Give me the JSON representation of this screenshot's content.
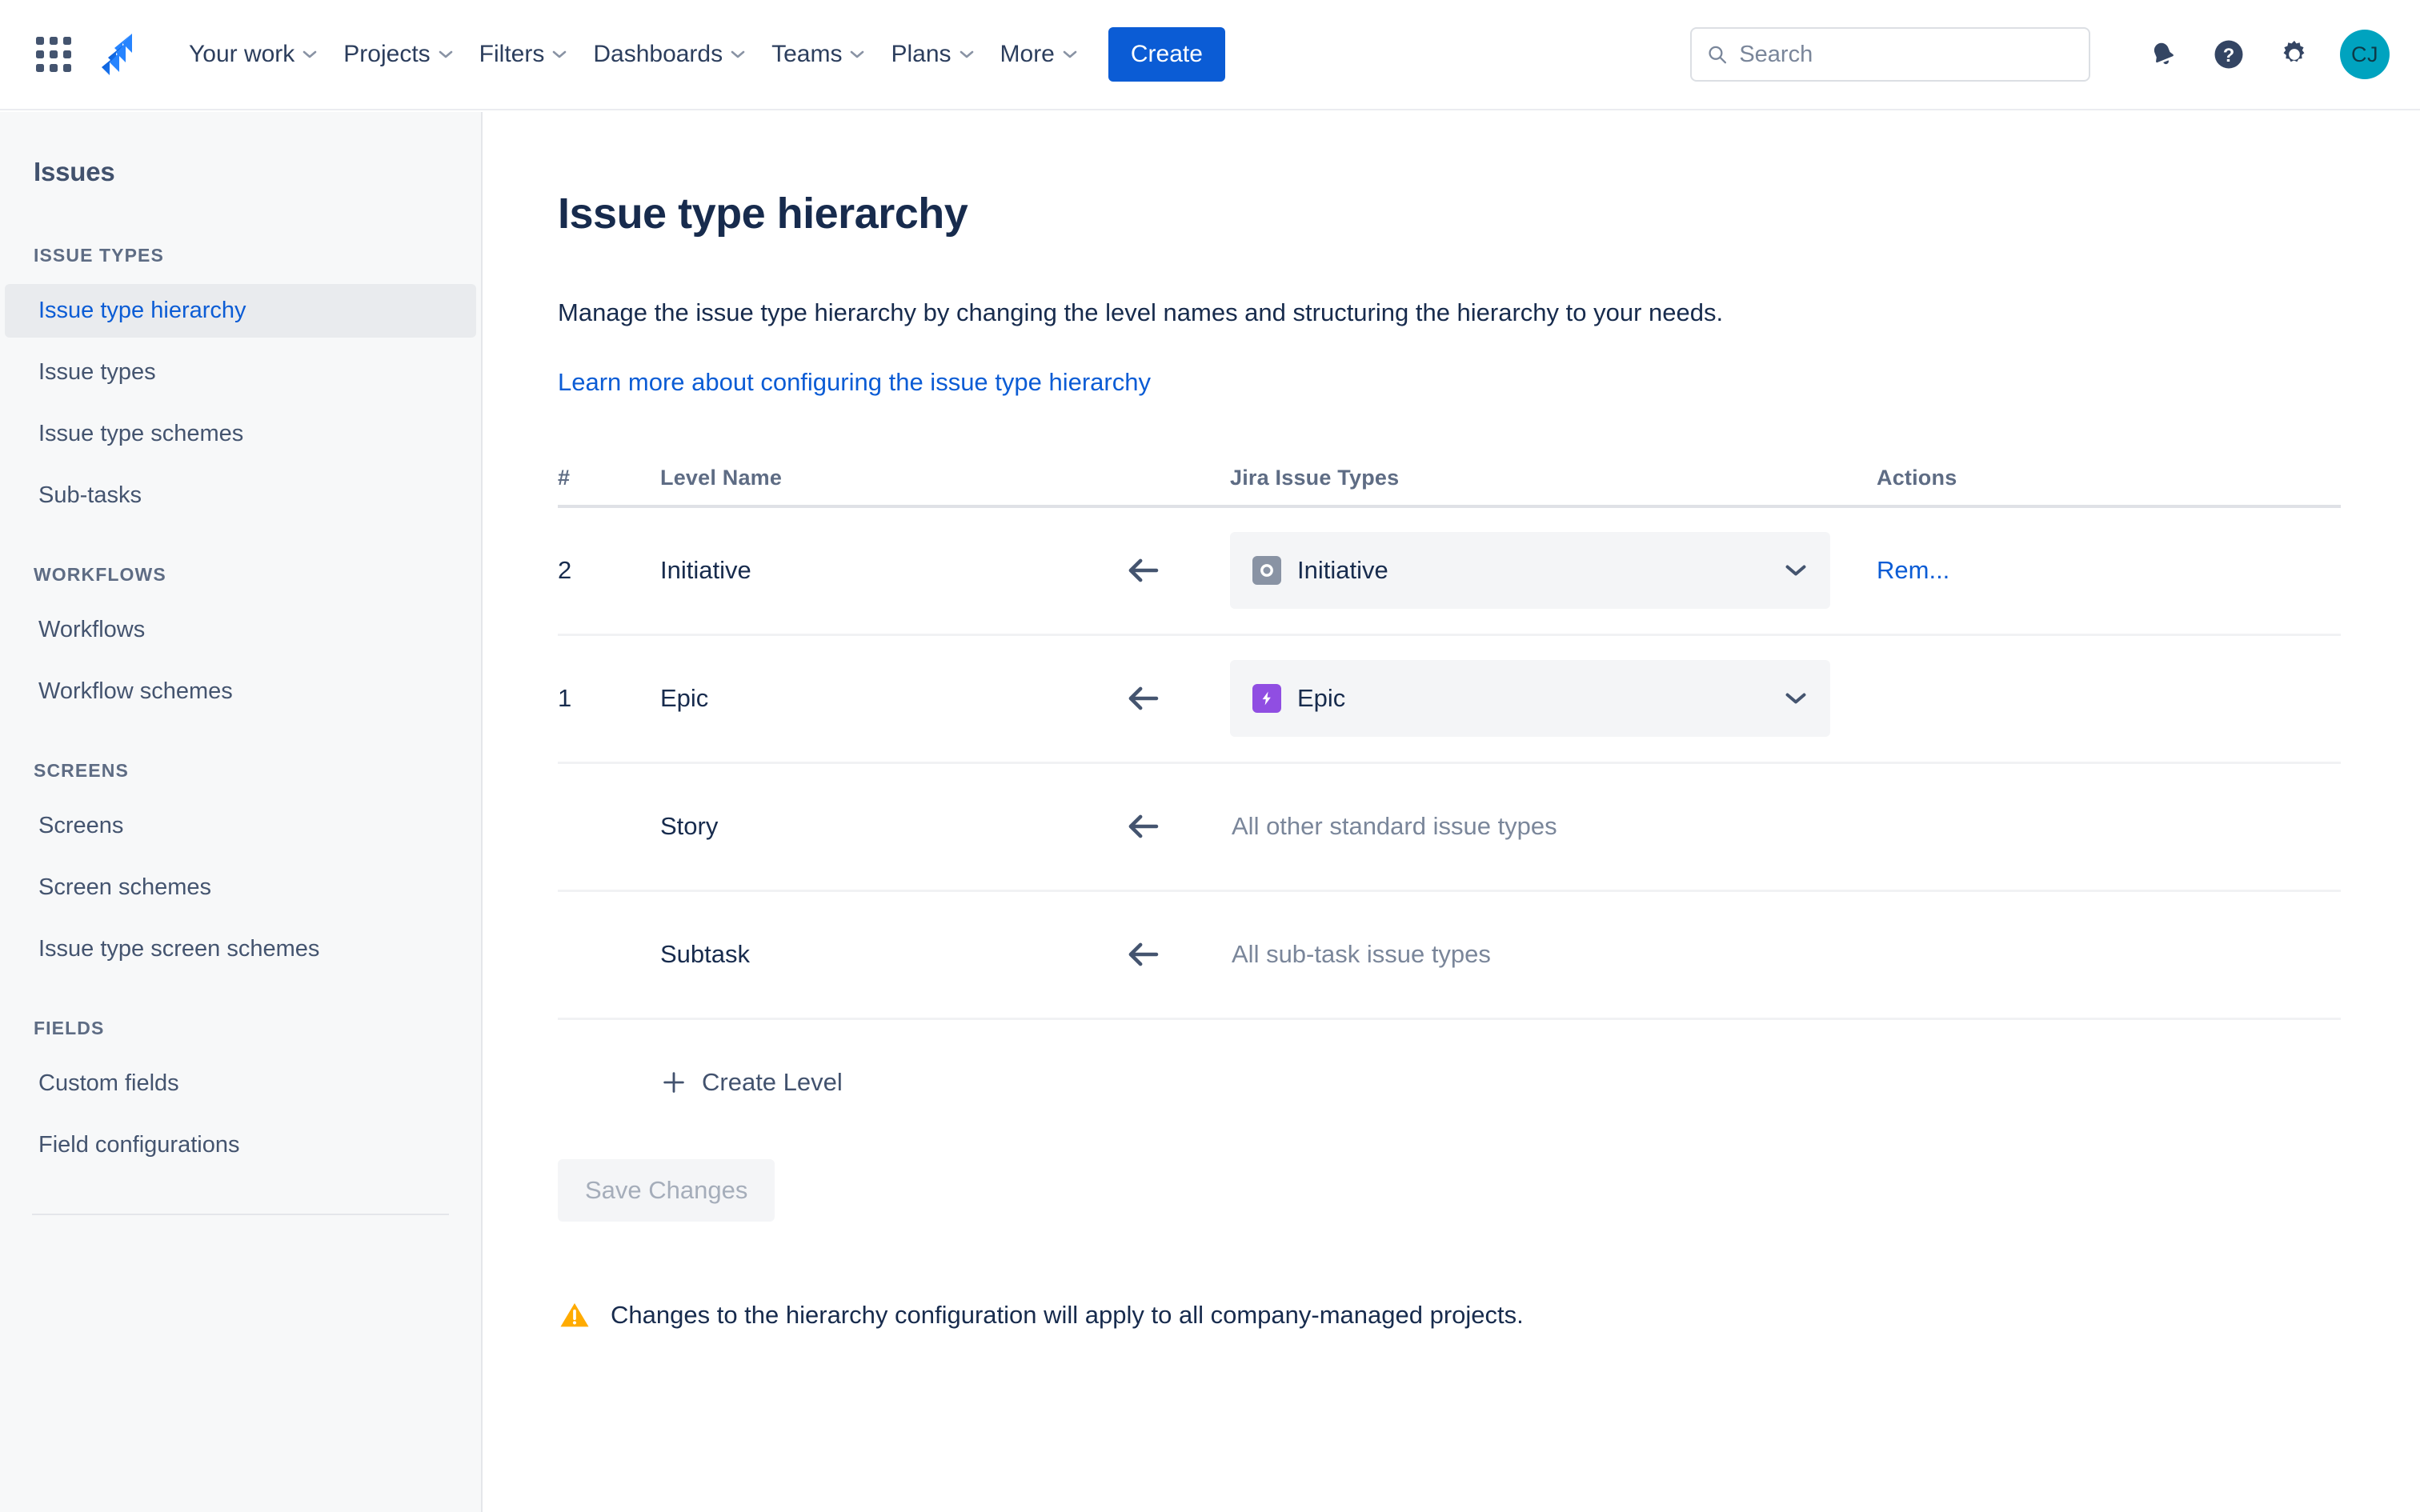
{
  "topnav": {
    "app_switcher_icon": "grid-apps-icon",
    "logo_icon": "jira-logo-icon",
    "items": [
      {
        "label": "Your work",
        "has_chevron": true
      },
      {
        "label": "Projects",
        "has_chevron": true
      },
      {
        "label": "Filters",
        "has_chevron": true
      },
      {
        "label": "Dashboards",
        "has_chevron": true
      },
      {
        "label": "Teams",
        "has_chevron": true
      },
      {
        "label": "Plans",
        "has_chevron": true
      },
      {
        "label": "More",
        "has_chevron": true
      }
    ],
    "create_label": "Create",
    "search": {
      "placeholder": "Search",
      "value": "",
      "icon": "search-icon"
    },
    "notifications_icon": "bell-icon",
    "help_icon": "help-circle-icon",
    "settings_icon": "gear-icon",
    "avatar_initials": "CJ"
  },
  "sidebar": {
    "title": "Issues",
    "groups": [
      {
        "heading": "ISSUE TYPES",
        "items": [
          {
            "label": "Issue type hierarchy",
            "active": true
          },
          {
            "label": "Issue types",
            "active": false
          },
          {
            "label": "Issue type schemes",
            "active": false
          },
          {
            "label": "Sub-tasks",
            "active": false
          }
        ]
      },
      {
        "heading": "WORKFLOWS",
        "items": [
          {
            "label": "Workflows",
            "active": false
          },
          {
            "label": "Workflow schemes",
            "active": false
          }
        ]
      },
      {
        "heading": "SCREENS",
        "items": [
          {
            "label": "Screens",
            "active": false
          },
          {
            "label": "Screen schemes",
            "active": false
          },
          {
            "label": "Issue type screen schemes",
            "active": false
          }
        ]
      },
      {
        "heading": "FIELDS",
        "items": [
          {
            "label": "Custom fields",
            "active": false
          },
          {
            "label": "Field configurations",
            "active": false
          }
        ]
      }
    ]
  },
  "main": {
    "title": "Issue type hierarchy",
    "description": "Manage the issue type hierarchy by changing the level names and structuring the hierarchy to your needs.",
    "learn_more_link": "Learn more about configuring the issue type hierarchy",
    "table": {
      "columns": [
        "#",
        "Level Name",
        "Jira Issue Types",
        "Actions"
      ],
      "rows": [
        {
          "number": "2",
          "level_name": "Initiative",
          "arrow_icon": "arrow-left-icon",
          "select": {
            "type": "select",
            "icon": "initiative-icon",
            "icon_color": "#8993A4",
            "value": "Initiative"
          },
          "action": "Rem..."
        },
        {
          "number": "1",
          "level_name": "Epic",
          "arrow_icon": "arrow-left-icon",
          "select": {
            "type": "select",
            "icon": "epic-bolt-icon",
            "icon_color": "#904EE2",
            "value": "Epic"
          },
          "action": ""
        },
        {
          "number": "",
          "level_name": "Story",
          "arrow_icon": "arrow-left-icon",
          "select": {
            "type": "static",
            "value": "All other standard issue types"
          },
          "action": ""
        },
        {
          "number": "",
          "level_name": "Subtask",
          "arrow_icon": "arrow-left-icon",
          "select": {
            "type": "static",
            "value": "All sub-task issue types"
          },
          "action": ""
        }
      ]
    },
    "create_level_label": "Create Level",
    "create_level_icon": "plus-icon",
    "save_label": "Save Changes",
    "warning": {
      "icon": "warning-triangle-icon",
      "text": "Changes to the hierarchy configuration will apply to all company-managed projects."
    }
  },
  "colors": {
    "brand_blue": "#0B5CD5",
    "link_blue": "#0B5CD5",
    "text_dark": "#172B4D",
    "text_muted": "#5E6C84",
    "placeholder": "#7A869A",
    "sidebar_bg": "#F7F8F9",
    "active_bg": "#E9EBEE",
    "select_bg": "#F4F5F7",
    "epic_purple": "#904EE2",
    "initiative_grey": "#8993A4",
    "avatar_teal": "#00A3BF",
    "warning_yellow": "#FFAB00"
  }
}
